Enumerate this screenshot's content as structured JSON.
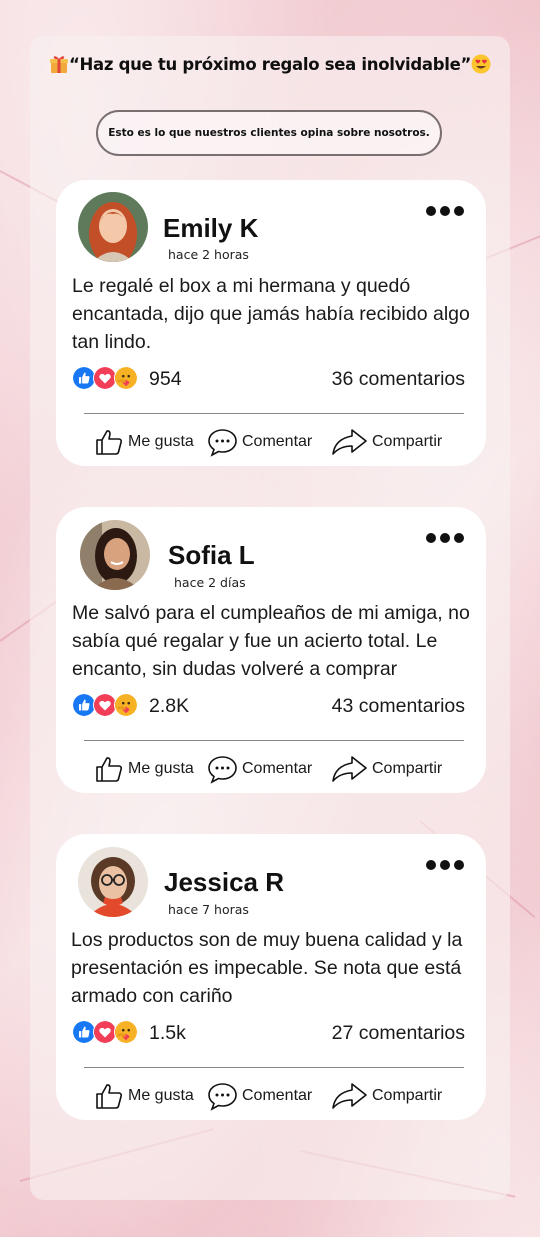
{
  "header": {
    "title": "“Haz que tu próximo regalo sea inolvidable”",
    "left_icon": "gift-icon",
    "right_icon": "heart-eyes-icon"
  },
  "subtitle": "Esto es lo que nuestros clientes opina sobre nosotros.",
  "actions": {
    "like": "Me gusta",
    "comment": "Comentar",
    "share": "Compartir"
  },
  "colors": {
    "like_blue": "#1877f2",
    "love_red": "#f33e58",
    "care_yellow": "#f7b125",
    "card_bg": "#ffffff"
  },
  "posts": [
    {
      "name": "Emily K",
      "time": "hace 2 horas",
      "text": "Le regalé el box a mi hermana y quedó encantada, dijo que jamás había recibido algo tan lindo.",
      "reaction_count": "954",
      "comments": "36 comentarios",
      "avatar": "avatar-red-hair"
    },
    {
      "name": "Sofia L",
      "time": "hace 2 días",
      "text": "Me salvó para el cumpleaños de mi amiga, no sabía qué regalar y fue un acierto total. Le encanto, sin dudas volveré a comprar",
      "reaction_count": "2.8K",
      "comments": "43 comentarios",
      "avatar": "avatar-dark-hair"
    },
    {
      "name": "Jessica R",
      "time": "hace 7 horas",
      "text": "Los productos son de muy buena calidad y la presentación es impecable. Se nota que está armado con cariño",
      "reaction_count": "1.5k",
      "comments": "27 comentarios",
      "avatar": "avatar-glasses"
    }
  ]
}
